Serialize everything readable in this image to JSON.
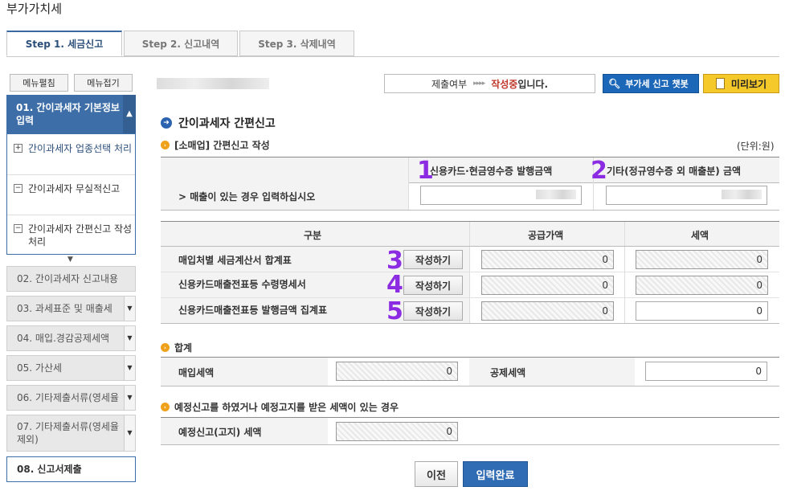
{
  "page_title": "부가가치세",
  "tabs": [
    {
      "label": "Step 1. 세금신고"
    },
    {
      "label": "Step 2. 신고내역"
    },
    {
      "label": "Step 3. 삭제내역"
    }
  ],
  "sidebar": {
    "expand_label": "메뉴펼침",
    "collapse_label": "메뉴접기",
    "active_menu": "01. 간이과세자 기본정보 입력",
    "sub_items": [
      {
        "label": "간이과세자 업종선택 처리"
      },
      {
        "label": "간이과세자 무실적신고"
      },
      {
        "label": "간이과세자 간편신고 작성 처리"
      }
    ],
    "menus": [
      {
        "label": "02. 간이과세자 신고내용"
      },
      {
        "label": "03. 과세표준 및 매출세"
      },
      {
        "label": "04. 매입.경감공제세액"
      },
      {
        "label": "05. 가산세"
      },
      {
        "label": "06. 기타제출서류(영세율"
      },
      {
        "label": "07. 기타제출서류(영세율 제외)"
      },
      {
        "label": "08. 신고서제출"
      }
    ]
  },
  "status": {
    "prefix": "제출여부",
    "arrows": "▸▸▸▸",
    "value": "작성중",
    "suffix": "입니다."
  },
  "chatbot_label": "부가세 신고 챗봇",
  "preview_label": "미리보기",
  "main": {
    "title": "간이과세자 간편신고",
    "section1": "[소매업] 간편신고 작성",
    "unit": "(단위:원)",
    "col_card": "신용카드·현금영수증 발행금액",
    "col_other": "기타(정규영수증 외 매출분) 금액",
    "sales_row_label": "> 매출이 있는 경우 입력하십시오",
    "table2": {
      "col_type": "구분",
      "col_supply": "공급가액",
      "col_tax": "세액",
      "write_label": "작성하기",
      "rows": [
        {
          "label": "매입처별 세금계산서 합계표",
          "supply": "0",
          "tax": "0"
        },
        {
          "label": "신용카드매출전표등 수령명세서",
          "supply": "0",
          "tax": "0"
        },
        {
          "label": "신용카드매출전표등 발행금액 집계표",
          "supply": "0",
          "tax": "0"
        }
      ]
    },
    "section2": "합계",
    "purchase_tax_label": "매입세액",
    "purchase_tax": "0",
    "deduct_tax_label": "공제세액",
    "deduct_tax": "0",
    "section3": "예정신고를 하였거나 예정고지를 받은 세액이 있는 경우",
    "prelim_label": "예정신고(고지) 세액",
    "prelim_value": "0",
    "prev_label": "이전",
    "complete_label": "입력완료"
  },
  "annotations": [
    "1",
    "2",
    "3",
    "4",
    "5"
  ],
  "colors": {
    "accent": "#3d6ea8",
    "annotation": "#8b2be2",
    "status_red": "#c0392b",
    "preview": "#f5c92a",
    "chatbot": "#1d67b8"
  }
}
